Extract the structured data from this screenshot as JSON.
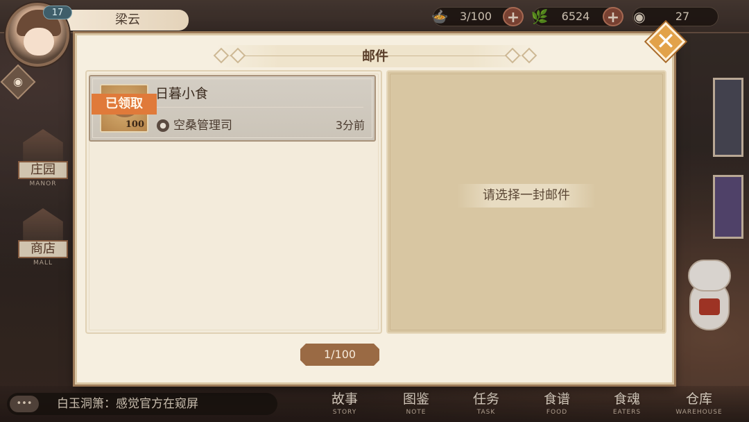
{
  "player": {
    "name": "梁云",
    "level": "17"
  },
  "resources": {
    "food": {
      "icon": "food-bowl-icon",
      "value": "3/100"
    },
    "jade": {
      "icon": "jade-leaf-icon",
      "value": "6524"
    },
    "coin": {
      "icon": "coin-icon",
      "value": "27"
    }
  },
  "side_nav": [
    {
      "label": "庄园",
      "en": "MANOR"
    },
    {
      "label": "商店",
      "en": "MALL"
    }
  ],
  "mail_modal": {
    "title": "邮件",
    "close_icon": "close-icon",
    "items": [
      {
        "title": "日暮小食",
        "sender": "空桑管理司",
        "time": "3分前",
        "status": "已领取",
        "reward_qty": "100"
      }
    ],
    "empty_hint": "请选择一封邮件",
    "pager": "1/100"
  },
  "chat": {
    "icon": "chat-bubble-icon",
    "message": "白玉洞箫：感觉官方在窥屏"
  },
  "bottom_nav": [
    {
      "label": "故事",
      "en": "STORY"
    },
    {
      "label": "图鉴",
      "en": "NOTE"
    },
    {
      "label": "任务",
      "en": "TASK"
    },
    {
      "label": "食谱",
      "en": "FOOD"
    },
    {
      "label": "食魂",
      "en": "EATERS"
    },
    {
      "label": "仓库",
      "en": "WAREHOUSE"
    }
  ],
  "colors": {
    "modal_bg": "#f6efe0",
    "accent_orange": "#e07a3a",
    "close_gold": "#e2a24a",
    "pager_brown": "#9a6a44"
  }
}
